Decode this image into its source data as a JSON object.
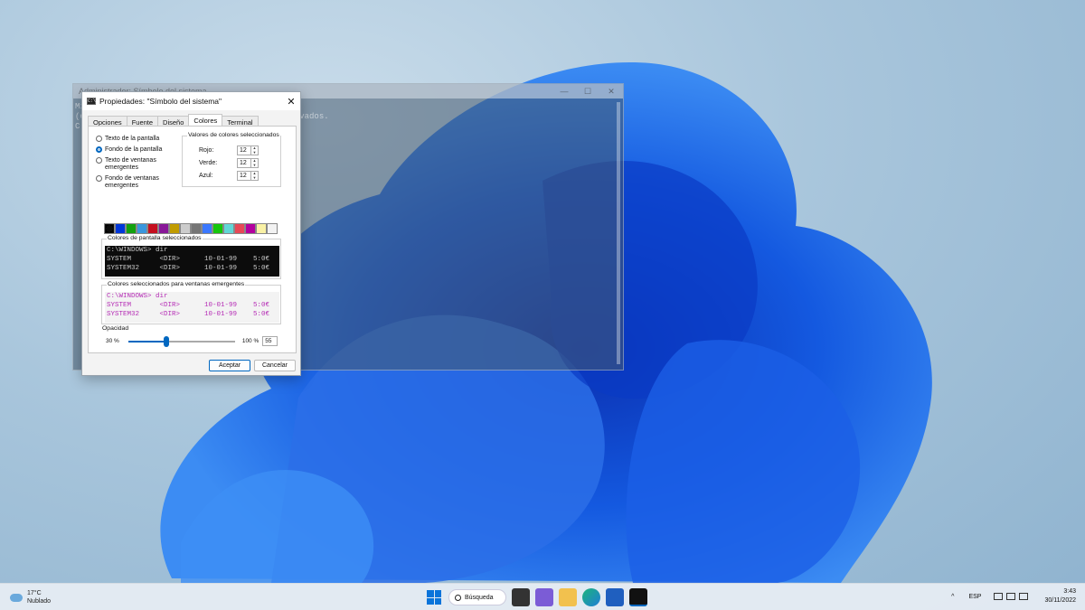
{
  "console": {
    "title": "Administrador: Símbolo del sistema",
    "lines": [
      "Mi",
      "(c",
      "",
      "C:"
    ],
    "line_fragment": "rvados."
  },
  "dialog": {
    "title": "Propiedades: \"Símbolo del sistema\"",
    "close_label": "✕",
    "tabs": [
      {
        "label": "Opciones"
      },
      {
        "label": "Fuente"
      },
      {
        "label": "Diseño"
      },
      {
        "label": "Colores",
        "active": true
      },
      {
        "label": "Terminal"
      }
    ],
    "radios": [
      {
        "label": "Texto de la pantalla",
        "checked": false
      },
      {
        "label": "Fondo de la pantalla",
        "checked": true
      },
      {
        "label": "Texto de ventanas emergentes",
        "checked": false
      },
      {
        "label": "Fondo de ventanas emergentes",
        "checked": false
      }
    ],
    "values_group": {
      "legend": "Valores de colores seleccionados",
      "rojo_label": "Rojo:",
      "rojo": "12",
      "verde_label": "Verde:",
      "verde": "12",
      "azul_label": "Azul:",
      "azul": "12"
    },
    "palette": [
      "#0c0c0c",
      "#0037da",
      "#13a10e",
      "#3a96dd",
      "#c50f1f",
      "#881798",
      "#c19c00",
      "#cccccc",
      "#767676",
      "#3b78ff",
      "#16c60c",
      "#61d6d6",
      "#e74856",
      "#b4009e",
      "#f9f1a5",
      "#f2f2f2"
    ],
    "selected_swatch": 0,
    "screen_group": {
      "legend": "Colores de pantalla seleccionados",
      "line1": "C:\\WINDOWS> dir",
      "line2": "SYSTEM       <DIR>      10-01-99    5:0€",
      "line3": "SYSTEM32     <DIR>      10-01-99    5:0€"
    },
    "popup_group": {
      "legend": "Colores seleccionados para ventanas emergentes",
      "line1": "C:\\WINDOWS> dir",
      "line2": "SYSTEM       <DIR>      10-01-99    5:0€",
      "line3": "SYSTEM32     <DIR>      10-01-99    5:0€"
    },
    "opacity": {
      "legend": "Opacidad",
      "min_label": "30 %",
      "max_label": "100 %",
      "value": "55",
      "fraction": 0.36
    },
    "ok_label": "Aceptar",
    "cancel_label": "Cancelar"
  },
  "taskbar": {
    "weather_temp": "17°C",
    "weather_desc": "Nublado",
    "search_label": "Búsqueda",
    "chevron": "^",
    "lang": "ESP",
    "time": "3:43",
    "date": "30/11/2022"
  }
}
